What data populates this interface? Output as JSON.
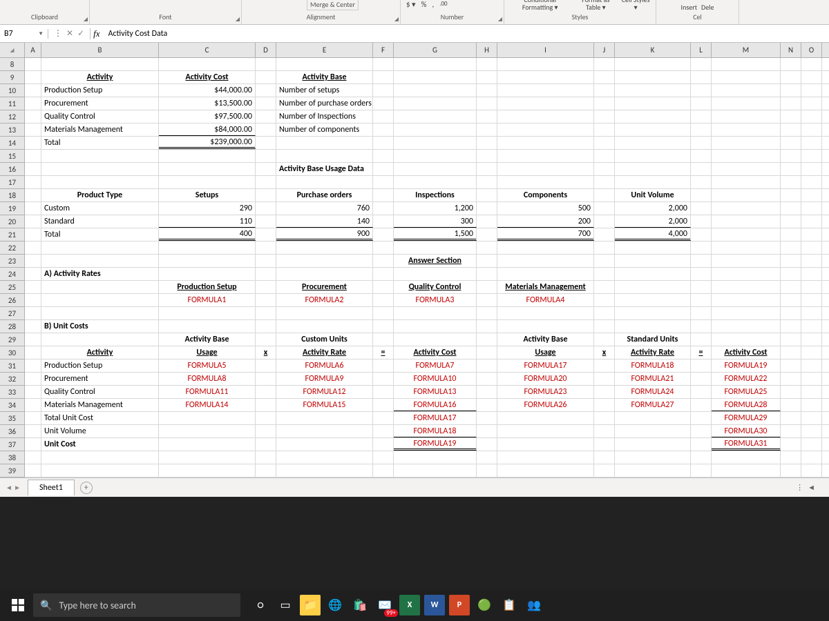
{
  "ribbon": {
    "groups": [
      "Clipboard",
      "Font",
      "Alignment",
      "Number",
      "Styles"
    ],
    "merge_center": "Merge & Center",
    "styles_items": {
      "conditional": "Conditional Formatting",
      "format_table": "Format as Table",
      "cell_styles": "Cell Styles"
    },
    "cells_items": {
      "insert": "Insert",
      "delete": "Dele"
    }
  },
  "namebox": "B7",
  "formula_bar": "Activity Cost Data",
  "columns": [
    "A",
    "B",
    "C",
    "D",
    "E",
    "F",
    "G",
    "H",
    "I",
    "J",
    "K",
    "L",
    "M",
    "N",
    "O"
  ],
  "rows_start": 8,
  "rows_end": 39,
  "sheet": {
    "r9": {
      "B": "Activity",
      "C": "Activity Cost",
      "E": "Activity Base"
    },
    "r10": {
      "B": "Production Setup",
      "Ccur": "$",
      "C": "44,000.00",
      "E": "Number of setups"
    },
    "r11": {
      "B": "Procurement",
      "Ccur": "$",
      "C": "13,500.00",
      "E": "Number of purchase orders"
    },
    "r12": {
      "B": "Quality Control",
      "Ccur": "$",
      "C": "97,500.00",
      "E": "Number of Inspections"
    },
    "r13": {
      "B": "Materials Management",
      "Ccur": "$",
      "C": "84,000.00",
      "E": "Number of components"
    },
    "r14": {
      "B": "Total",
      "Ccur": "$",
      "C": "239,000.00"
    },
    "r16": {
      "E": "Activity Base Usage Data"
    },
    "r18": {
      "B": "Product Type",
      "C": "Setups",
      "E": "Purchase orders",
      "G": "Inspections",
      "I": "Components",
      "K": "Unit Volume"
    },
    "r19": {
      "B": "Custom",
      "C": "290",
      "E": "760",
      "G": "1,200",
      "I": "500",
      "K": "2,000"
    },
    "r20": {
      "B": "Standard",
      "C": "110",
      "E": "140",
      "G": "300",
      "I": "200",
      "K": "2,000"
    },
    "r21": {
      "B": "Total",
      "C": "400",
      "E": "900",
      "G": "1,500",
      "I": "700",
      "K": "4,000"
    },
    "r23": {
      "G": "Answer Section"
    },
    "r24": {
      "B": "A) Activity Rates"
    },
    "r25": {
      "C": "Production Setup",
      "E": "Procurement",
      "G": "Quality Control",
      "I": "Materials Management"
    },
    "r26": {
      "C": "FORMULA1",
      "E": "FORMULA2",
      "G": "FORMULA3",
      "I": "FORMULA4"
    },
    "r28": {
      "B": "B) Unit Costs"
    },
    "r29": {
      "E": "Custom Units",
      "K": "Standard Units"
    },
    "r30a": {
      "C": "Activity Base",
      "I": "Activity Base"
    },
    "r30": {
      "B": "Activity",
      "C": "Usage",
      "D": "x",
      "E": "Activity Rate",
      "F": "=",
      "G": "Activity Cost",
      "I": "Usage",
      "J": "x",
      "K": "Activity Rate",
      "L": "=",
      "M": "Activity Cost"
    },
    "r31": {
      "B": "Production Setup",
      "C": "FORMULA5",
      "E": "FORMULA6",
      "G": "FORMULA7",
      "I": "FORMULA17",
      "K": "FORMULA18",
      "M": "FORMULA19"
    },
    "r32": {
      "B": "Procurement",
      "C": "FORMULA8",
      "E": "FORMULA9",
      "G": "FORMULA10",
      "I": "FORMULA20",
      "K": "FORMULA21",
      "M": "FORMULA22"
    },
    "r33": {
      "B": "Quality Control",
      "C": "FORMULA11",
      "E": "FORMULA12",
      "G": "FORMULA13",
      "I": "FORMULA23",
      "K": "FORMULA24",
      "M": "FORMULA25"
    },
    "r34": {
      "B": "Materials Management",
      "C": "FORMULA14",
      "E": "FORMULA15",
      "G": "FORMULA16",
      "I": "FORMULA26",
      "K": "FORMULA27",
      "M": "FORMULA28"
    },
    "r35": {
      "B": "Total Unit Cost",
      "G": "FORMULA17",
      "M": "FORMULA29"
    },
    "r36": {
      "B": "Unit Volume",
      "G": "FORMULA18",
      "M": "FORMULA30"
    },
    "r37": {
      "B": "Unit Cost",
      "G": "FORMULA19",
      "M": "FORMULA31"
    }
  },
  "sheet_tab": "Sheet1",
  "taskbar": {
    "search_placeholder": "Type here to search",
    "badge": "99+"
  }
}
